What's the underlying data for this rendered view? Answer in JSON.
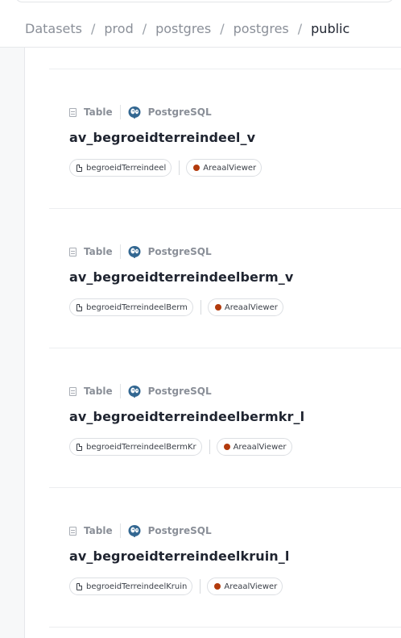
{
  "breadcrumb": {
    "items": [
      "Datasets",
      "prod",
      "postgres",
      "postgres"
    ],
    "current": "public",
    "separator": "/"
  },
  "colors": {
    "owner_dot": "#b23a0c",
    "accent_text": "#1f2430",
    "muted_text": "#8a8f98"
  },
  "results": [
    {
      "type_label": "Table",
      "platform_label": "PostgreSQL",
      "platform_icon": "postgresql-icon",
      "title": "av_begroeidterreindeel_v",
      "glossary_term": "begroeidTerreindeel",
      "owner": "AreaalViewer"
    },
    {
      "type_label": "Table",
      "platform_label": "PostgreSQL",
      "platform_icon": "postgresql-icon",
      "title": "av_begroeidterreindeelberm_v",
      "glossary_term": "begroeidTerreindeelBerm",
      "owner": "AreaalViewer"
    },
    {
      "type_label": "Table",
      "platform_label": "PostgreSQL",
      "platform_icon": "postgresql-icon",
      "title": "av_begroeidterreindeelbermkr_l",
      "glossary_term": "begroeidTerreindeelBermKr",
      "owner": "AreaalViewer"
    },
    {
      "type_label": "Table",
      "platform_label": "PostgreSQL",
      "platform_icon": "postgresql-icon",
      "title": "av_begroeidterreindeelkruin_l",
      "glossary_term": "begroeidTerreindeelKruin",
      "owner": "AreaalViewer"
    }
  ]
}
